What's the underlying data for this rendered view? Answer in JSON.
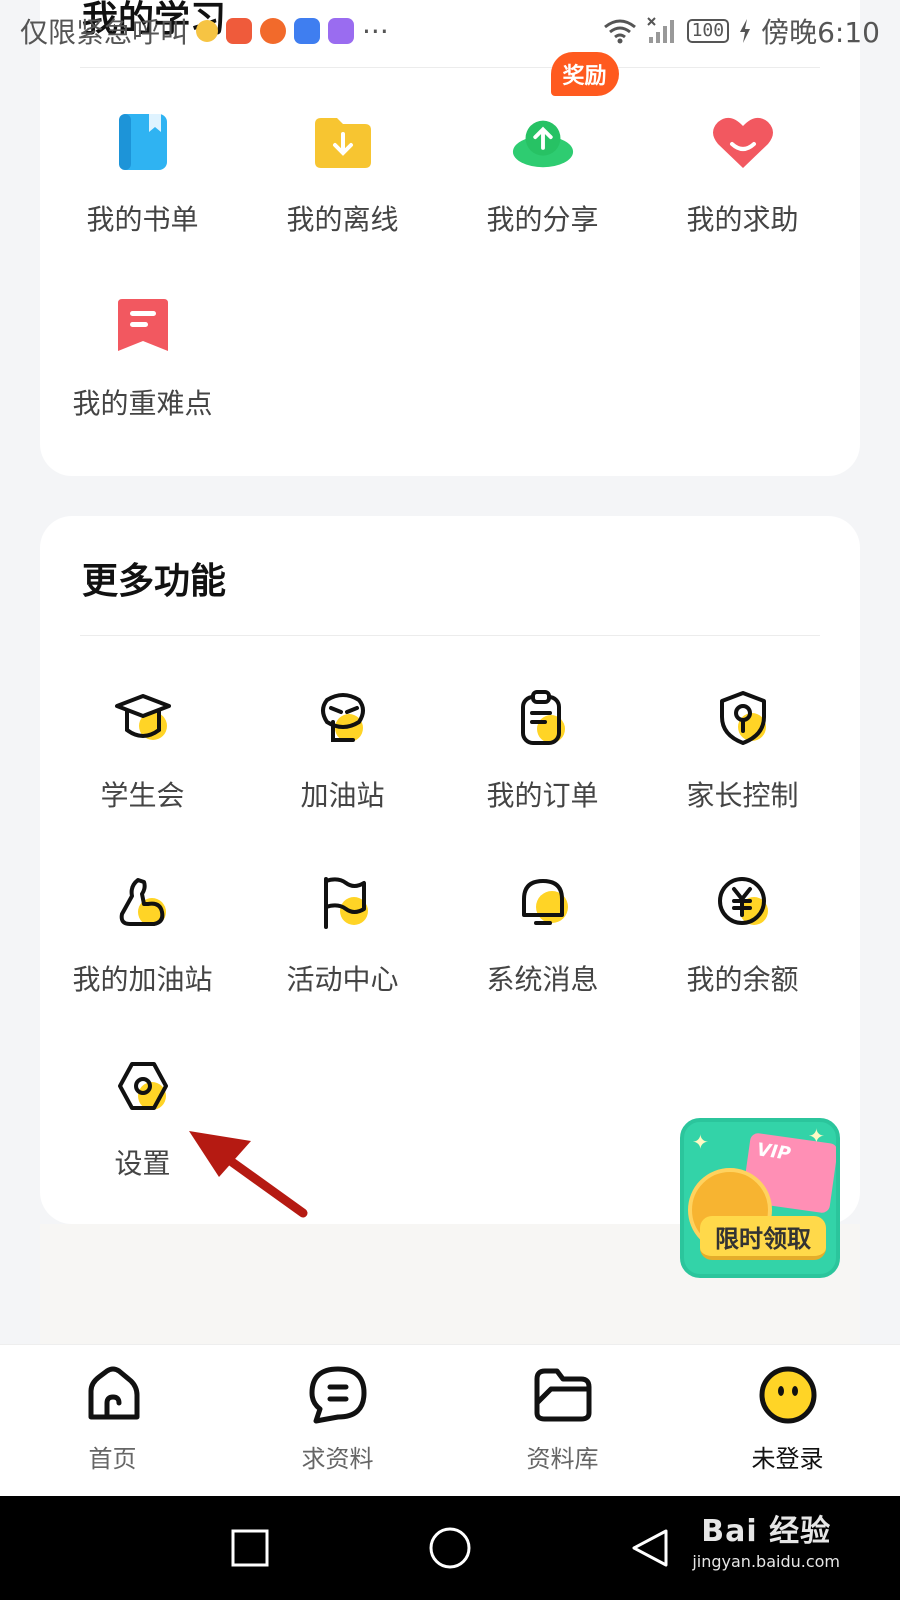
{
  "status_bar": {
    "left_text": "仅限紧急呼叫",
    "battery": "100",
    "time": "傍晚6:10",
    "more": "···"
  },
  "study_section": {
    "title": "我的学习",
    "items": [
      {
        "label": "我的书单",
        "icon": "book-icon"
      },
      {
        "label": "我的离线",
        "icon": "download-folder-icon"
      },
      {
        "label": "我的分享",
        "icon": "cloud-upload-icon",
        "badge": "奖励"
      },
      {
        "label": "我的求助",
        "icon": "heart-help-icon"
      },
      {
        "label": "我的重难点",
        "icon": "bookmark-note-icon"
      }
    ]
  },
  "more_section": {
    "title": "更多功能",
    "items": [
      {
        "label": "学生会",
        "icon": "graduation-cap-icon"
      },
      {
        "label": "加油站",
        "icon": "face-mask-icon"
      },
      {
        "label": "我的订单",
        "icon": "clipboard-icon"
      },
      {
        "label": "家长控制",
        "icon": "shield-key-icon"
      },
      {
        "label": "我的加油站",
        "icon": "muscle-arm-icon"
      },
      {
        "label": "活动中心",
        "icon": "flag-icon"
      },
      {
        "label": "系统消息",
        "icon": "bell-icon"
      },
      {
        "label": "我的余额",
        "icon": "yuan-coin-icon"
      },
      {
        "label": "设置",
        "icon": "settings-hex-icon"
      }
    ]
  },
  "promo": {
    "vip_text": "VIP",
    "label": "限时领取"
  },
  "tab_bar": {
    "tabs": [
      {
        "label": "首页",
        "icon": "home-icon"
      },
      {
        "label": "求资料",
        "icon": "chat-bubble-icon"
      },
      {
        "label": "资料库",
        "icon": "folder-icon"
      },
      {
        "label": "未登录",
        "icon": "avatar-smile-icon",
        "active": true
      }
    ]
  },
  "watermark": {
    "main": "Bai 经验",
    "sub": "jingyan.baidu.com"
  },
  "colors": {
    "accent_yellow": "#ffd426",
    "badge_orange": "#ff5a1f",
    "arrow_red": "#b51a12"
  }
}
